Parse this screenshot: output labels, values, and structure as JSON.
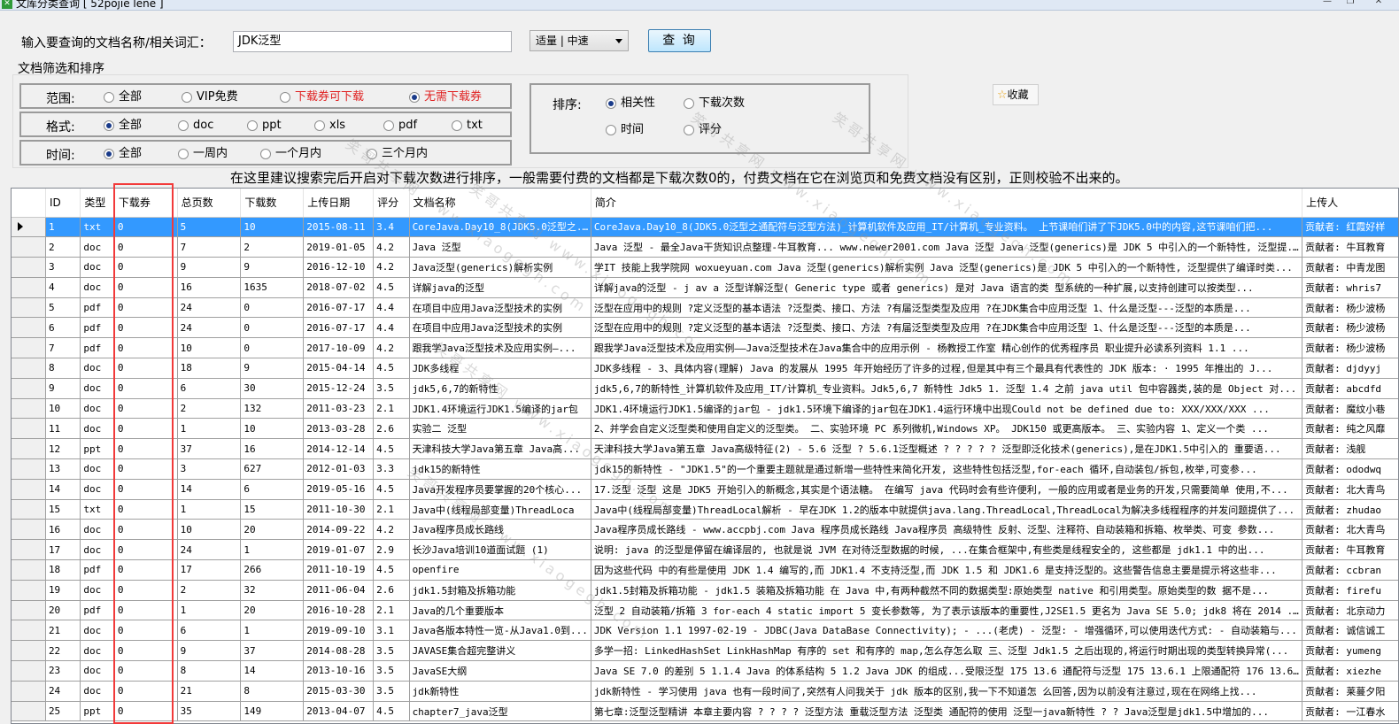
{
  "window": {
    "title": "文库分类查询 [ 52pojie lene ]",
    "minimize": "—",
    "maximize": "❐",
    "close": "✕"
  },
  "search": {
    "label": "输入要查询的文档名称/相关词汇：",
    "value": "JDK泛型",
    "speed": "适量 | 中速",
    "button": "查 询"
  },
  "filters": {
    "title": "文档筛选和排序",
    "scope": {
      "label": "范围:",
      "options": [
        "全部",
        "VIP免费",
        "下载券可下载",
        "无需下载券"
      ]
    },
    "format": {
      "label": "格式:",
      "options": [
        "全部",
        "doc",
        "ppt",
        "xls",
        "pdf",
        "txt"
      ]
    },
    "time": {
      "label": "时间:",
      "options": [
        "全部",
        "一周内",
        "一个月内",
        "三个月内"
      ]
    },
    "sort": {
      "label": "排序:",
      "options": [
        "相关性",
        "下载次数",
        "时间",
        "评分"
      ]
    },
    "favorite": "收藏"
  },
  "hint": "在这里建议搜索完后开启对下载次数进行排序，一般需要付费的文档都是下载次数0的，付费文档在它在浏览页和免费文档没有区别，正则校验不出来的。",
  "watermark": "笑哥共享网 www.xiaogegh.com",
  "table": {
    "columns": [
      "ID",
      "类型",
      "下载券",
      "总页数",
      "下载数",
      "上传日期",
      "评分",
      "文档名称",
      "简介",
      "上传人"
    ],
    "rows": [
      [
        "1",
        "txt",
        "0",
        "5",
        "10",
        "2015-08-11",
        "3.4",
        "CoreJava.Day10_8(JDK5.0泛型之...",
        "CoreJava.Day10_8(JDK5.0泛型之通配符与泛型方法)_计算机软件及应用_IT/计算机_专业资料。 上节课咱们讲了下JDK5.0中的内容,这节课咱们把...",
        "贡献者: 红霞好样"
      ],
      [
        "2",
        "doc",
        "0",
        "7",
        "2",
        "2019-01-05",
        "4.2",
        "Java 泛型",
        "Java 泛型 - 最全Java干货知识点整理-牛耳教育... www.newer2001.com Java 泛型 Java 泛型(generics)是 JDK 5 中引入的一个新特性, 泛型提...",
        "贡献者: 牛耳教育"
      ],
      [
        "3",
        "doc",
        "0",
        "9",
        "9",
        "2016-12-10",
        "4.2",
        "Java泛型(generics)解析实例",
        "学IT 技能上我学院网 woxueyuan.com Java 泛型(generics)解析实例 Java 泛型(generics)是 JDK 5 中引入的一个新特性, 泛型提供了编译时类...",
        "贡献者: 中青龙图"
      ],
      [
        "4",
        "doc",
        "0",
        "16",
        "1635",
        "2018-07-02",
        "4.5",
        "详解java的泛型",
        "详解java的泛型 - j av a 泛型详解泛型( Generic type 或者 generics) 是对 Java 语言的类 型系统的一种扩展,以支持创建可以按类型...",
        "贡献者: whris7"
      ],
      [
        "5",
        "pdf",
        "0",
        "24",
        "0",
        "2016-07-17",
        "4.4",
        "在项目中应用Java泛型技术的实例",
        "泛型在应用中的规则 ?定义泛型的基本语法 ?泛型类、接口、方法 ?有届泛型类型及应用 ?在JDK集合中应用泛型 1、什么是泛型---泛型的本质是...",
        "贡献者: 杨少波杨"
      ],
      [
        "6",
        "pdf",
        "0",
        "24",
        "0",
        "2016-07-17",
        "4.4",
        "在项目中应用Java泛型技术的实例",
        "泛型在应用中的规则 ?定义泛型的基本语法 ?泛型类、接口、方法 ?有届泛型类型及应用 ?在JDK集合中应用泛型 1、什么是泛型---泛型的本质是...",
        "贡献者: 杨少波杨"
      ],
      [
        "7",
        "pdf",
        "0",
        "10",
        "0",
        "2017-10-09",
        "4.2",
        "跟我学Java泛型技术及应用实例—...",
        "跟我学Java泛型技术及应用实例——Java泛型技术在Java集合中的应用示例 - 杨教授工作室 精心创作的优秀程序员 职业提升必读系列资料 1.1 ...",
        "贡献者: 杨少波杨"
      ],
      [
        "8",
        "doc",
        "0",
        "18",
        "9",
        "2015-04-14",
        "4.5",
        "JDK多线程",
        "JDK多线程 - 3、具体内容(理解) Java 的发展从 1995 年开始经历了许多的过程,但是其中有三个最具有代表性的 JDK 版本: · 1995 年推出的 J...",
        "贡献者: djdyyj"
      ],
      [
        "9",
        "doc",
        "0",
        "6",
        "30",
        "2015-12-24",
        "3.5",
        "jdk5,6,7的新特性",
        "jdk5,6,7的新特性_计算机软件及应用_IT/计算机_专业资料。Jdk5,6,7 新特性 Jdk5 1. 泛型 1.4 之前 java util 包中容器类,装的是 Object 对...",
        "贡献者: abcdfd"
      ],
      [
        "10",
        "doc",
        "0",
        "2",
        "132",
        "2011-03-23",
        "2.1",
        "JDK1.4环境运行JDK1.5编译的jar包",
        "JDK1.4环境运行JDK1.5编译的jar包 - jdk1.5环境下编译的jar包在JDK1.4运行环境中出现Could not be defined due to: XXX/XXX/XXX ...",
        "贡献者: 魔纹小巷"
      ],
      [
        "11",
        "doc",
        "0",
        "1",
        "10",
        "2013-03-28",
        "2.6",
        "实验二  泛型",
        "2、并学会自定义泛型类和使用自定义的泛型类。 二、实验环境 PC 系列微机,Windows XP。 JDK150 或更高版本。 三、实验内容 1、定义一个类 ...",
        "贡献者: 纯之风靡"
      ],
      [
        "12",
        "ppt",
        "0",
        "37",
        "16",
        "2014-12-14",
        "4.5",
        "天津科技大学Java第五章  Java高...",
        "天津科技大学Java第五章 Java高级特征(2) - 5.6 泛型 ? 5.6.1泛型概述 ? ? ? ? ? 泛型即泛化技术(generics),是在JDK1.5中引入的 重要语...",
        "贡献者: 浅舰"
      ],
      [
        "13",
        "doc",
        "0",
        "3",
        "627",
        "2012-01-03",
        "3.3",
        "jdk15的新特性",
        "jdk15的新特性 - \"JDK1.5\"的一个重要主题就是通过新增一些特性来简化开发, 这些特性包括泛型,for-each 循环,自动装包/拆包,枚举,可变参...",
        "贡献者: ododwq"
      ],
      [
        "14",
        "doc",
        "0",
        "14",
        "6",
        "2019-05-16",
        "4.5",
        "Java开发程序员要掌握的20个核心...",
        "17.泛型 泛型 这是 JDK5 开始引入的新概念,其实是个语法糖。 在编写 java 代码时会有些许便利, 一般的应用或者是业务的开发,只需要简单 使用,不...",
        "贡献者: 北大青鸟"
      ],
      [
        "15",
        "txt",
        "0",
        "1",
        "15",
        "2011-10-30",
        "2.1",
        "Java中(线程局部变量)ThreadLoca",
        "Java中(线程局部变量)ThreadLocal解析 - 早在JDK 1.2的版本中就提供java.lang.ThreadLocal,ThreadLocal为解决多线程程序的并发问题提供了...",
        "贡献者: zhudao"
      ],
      [
        "16",
        "doc",
        "0",
        "10",
        "20",
        "2014-09-22",
        "4.2",
        "Java程序员成长路线",
        "Java程序员成长路线 - www.accpbj.com Java 程序员成长路线 Java程序员 高级特性 反射、泛型、注释符、自动装箱和拆箱、枚举类、可变 参数...",
        "贡献者: 北大青鸟"
      ],
      [
        "17",
        "doc",
        "0",
        "24",
        "1",
        "2019-01-07",
        "2.9",
        "长沙Java培训10道面试题 (1)",
        "说明: java 的泛型是停留在编译层的, 也就是说 JVM 在对待泛型数据的时候, ...在集合框架中,有些类是线程安全的, 这些都是 jdk1.1 中的出...",
        "贡献者: 牛耳教育"
      ],
      [
        "18",
        "pdf",
        "0",
        "17",
        "266",
        "2011-10-19",
        "4.5",
        "openfire",
        "因为这些代码 中的有些是使用 JDK 1.4 编写的,而 JDK1.4 不支持泛型,而 JDK 1.5 和 JDK1.6 是支持泛型的。这些警告信息主要是提示将这些非...",
        "贡献者: ccbran"
      ],
      [
        "19",
        "doc",
        "0",
        "2",
        "32",
        "2011-06-04",
        "2.6",
        "jdk1.5封箱及拆箱功能",
        "jdk1.5封箱及拆箱功能 - jdk1.5 装箱及拆箱功能 在 Java 中,有两种截然不同的数据类型:原始类型 native 和引用类型。原始类型的数 据不是...",
        "贡献者: firefu"
      ],
      [
        "20",
        "pdf",
        "0",
        "1",
        "20",
        "2016-10-28",
        "2.1",
        "Java的几个重要版本",
        "泛型 2 自动装箱/拆箱 3 for-each 4 static import 5 变长参数等, 为了表示该版本的重要性,J2SE1.5 更名为 Java SE 5.0; jdk8 将在 2014 ...",
        "贡献者: 北京动力"
      ],
      [
        "21",
        "doc",
        "0",
        "6",
        "1",
        "2019-09-10",
        "3.1",
        "Java各版本特性一览-从Java1.0到...",
        "JDK Version 1.1 1997-02-19 - JDBC(Java DataBase Connectivity); - ...(老虎) - 泛型: - 增强循环,可以使用迭代方式: - 自动装箱与...",
        "贡献者: 诚信诚工"
      ],
      [
        "22",
        "doc",
        "0",
        "9",
        "37",
        "2014-08-28",
        "3.5",
        "JAVASE集合超完整讲义",
        "多学一招: LinkedHashSet LinkHashMap 有序的 set 和有序的 map,怎么存怎么取 三、泛型 Jdk1.5 之后出现的,将运行时期出现的类型转换异常(...",
        "贡献者: yumeng"
      ],
      [
        "23",
        "doc",
        "0",
        "8",
        "14",
        "2013-10-16",
        "3.5",
        "JavaSE大纲",
        "Java SE 7.0 的差别 5 1.1.4 Java 的体系结构 5 1.2 Java JDK 的组成...受限泛型 175 13.6 通配符与泛型 175 13.6.1 上限通配符 176 13.6...",
        "贡献者: xiezhe"
      ],
      [
        "24",
        "doc",
        "0",
        "21",
        "8",
        "2015-03-30",
        "3.5",
        "jdk新特性",
        "jdk新特性 - 学习使用 java 也有一段时间了,突然有人问我关于 jdk 版本的区别,我一下不知道怎 么回答,因为以前没有注意过,现在在网络上找...",
        "贡献者: 莱蔓夕阳"
      ],
      [
        "25",
        "ppt",
        "0",
        "35",
        "149",
        "2013-04-07",
        "4.5",
        "chapter7_java泛型",
        "第七章:泛型泛型精讲 本章主要内容 ? ? ? ? 泛型方法 重载泛型方法 泛型类 通配符的使用 泛型一java新特性 ? ? Java泛型是jdk1.5中增加的...",
        "贡献者: 一江春水"
      ]
    ]
  }
}
